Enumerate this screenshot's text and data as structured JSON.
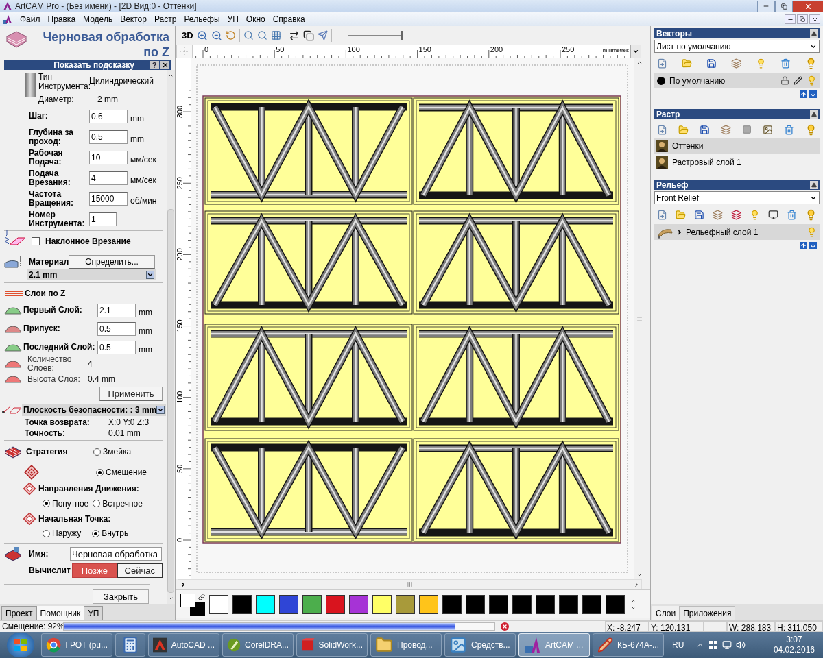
{
  "window": {
    "title": "ArtCAM Pro - (Без имени) - [2D Вид:0 - Оттенки]"
  },
  "menu": [
    "Файл",
    "Правка",
    "Модель",
    "Вектор",
    "Растр",
    "Рельефы",
    "УП",
    "Окно",
    "Справка"
  ],
  "left_panel": {
    "title": "Черновая обработка по Z",
    "hint": "Показать подсказку",
    "help": "?",
    "tool": {
      "type_label": "Тип Инструмента:",
      "type_value": "Цилиндрический",
      "diameter_label": "Диаметр:",
      "diameter_value": "2 mm"
    },
    "fields": [
      {
        "label": "Шаг:",
        "value": "0.6",
        "unit": "mm"
      },
      {
        "label": "Глубина за проход:",
        "value": "0.5",
        "unit": "mm"
      },
      {
        "label": "Рабочая Подача:",
        "value": "10",
        "unit": "мм/сек"
      },
      {
        "label": "Подача Врезания:",
        "value": "4",
        "unit": "мм/сек"
      },
      {
        "label": "Частота Вращения:",
        "value": "15000",
        "unit": "об/мин"
      },
      {
        "label": "Номер Инструмента:",
        "value": "1"
      }
    ],
    "ramp": {
      "label": "Наклонное Врезание",
      "checked": false
    },
    "material": {
      "label": "Материал",
      "button": "Определить...",
      "value": "2.1 mm"
    },
    "z_layers": {
      "title": "Слои по Z",
      "fields": [
        {
          "label": "Первый Слой:",
          "value": "2.1",
          "unit": "mm"
        },
        {
          "label": "Припуск:",
          "value": "0.5",
          "unit": "mm"
        },
        {
          "label": "Последний Слой:",
          "value": "0.5",
          "unit": "mm"
        }
      ],
      "info": [
        {
          "label": "Количество Слоев:",
          "value": "4"
        },
        {
          "label": "Высота Слоя:",
          "value": "0.4 mm"
        }
      ],
      "apply": "Применить"
    },
    "safe": {
      "label": "Плоскость безопасности: : 3 mm",
      "rows": [
        {
          "label": "Точка возврата:",
          "value": "X:0 Y:0 Z:3"
        },
        {
          "label": "Точность:",
          "value": "0.01 mm"
        }
      ]
    },
    "strategy": {
      "label": "Стратегия",
      "options": [
        {
          "label": "Змейка",
          "selected": false
        },
        {
          "label": "Смещение",
          "selected": true
        }
      ]
    },
    "direction": {
      "label": "Направления Движения:",
      "options": [
        {
          "label": "Попутное",
          "selected": true
        },
        {
          "label": "Встречное",
          "selected": false
        }
      ]
    },
    "start": {
      "label": "Начальная Точка:",
      "options": [
        {
          "label": "Наружу",
          "selected": false
        },
        {
          "label": "Внутрь",
          "selected": true
        }
      ]
    },
    "name": {
      "label": "Имя:",
      "value": "Черновая обработка"
    },
    "compute": {
      "label": "Вычислит",
      "buttons": [
        {
          "label": "Позже",
          "selected": true
        },
        {
          "label": "Сейчас",
          "selected": false
        }
      ]
    },
    "close": "Закрыть",
    "tabs": [
      {
        "label": "Проект",
        "selected": false
      },
      {
        "label": "Помощник",
        "selected": true
      },
      {
        "label": "УП",
        "selected": false
      }
    ]
  },
  "view": {
    "toolbar_label": "3D",
    "slider": {
      "level": 1
    },
    "x_labels": [
      "0",
      "50",
      "100",
      "150",
      "200",
      "250"
    ],
    "unit": "millimetres",
    "y_labels": [
      "300",
      "250",
      "200",
      "150",
      "100",
      "50",
      "0"
    ],
    "palette": [
      {
        "color": "#ffffff"
      },
      {
        "color": "#000000"
      },
      {
        "color": "#00ffff"
      },
      {
        "color": "#2f45d6"
      },
      {
        "color": "#4cae4c"
      },
      {
        "color": "#d9141e"
      },
      {
        "color": "#a633d6"
      },
      {
        "color": "#ffff66"
      },
      {
        "color": "#a89a3a"
      },
      {
        "color": "#ffc41a"
      },
      {
        "color": "#000000"
      },
      {
        "color": "#000000"
      },
      {
        "color": "#000000"
      },
      {
        "color": "#000000"
      },
      {
        "color": "#000000"
      },
      {
        "color": "#000000"
      },
      {
        "color": "#000000"
      },
      {
        "color": "#000000"
      }
    ]
  },
  "right_panel": {
    "vectors": {
      "title": "Векторы",
      "sheet": "Лист по умолчанию",
      "layers": [
        {
          "label": "По умолчанию",
          "selected": true
        }
      ]
    },
    "raster": {
      "title": "Растр",
      "layers": [
        {
          "label": "Оттенки",
          "selected": true
        },
        {
          "label": "Растровый слой 1",
          "selected": false
        }
      ]
    },
    "relief": {
      "title": "Рельеф",
      "sheet": "Front Relief",
      "layers": [
        {
          "label": "Рельефный слой 1",
          "selected": true
        }
      ]
    },
    "tabs": [
      {
        "label": "Слои",
        "selected": true
      },
      {
        "label": "Приложения",
        "selected": false
      }
    ]
  },
  "status_bar": {
    "text": "Смещение: 92%",
    "level": 0.91,
    "x": "X: -8.247",
    "y": "Y: 120.131",
    "w": "W: 288.183",
    "h": "H: 311.050"
  },
  "taskbar": {
    "items": [
      {
        "kind": "browser",
        "label": "ГРОТ (pu...",
        "selected": false
      },
      {
        "kind": "calculator",
        "selected": false
      },
      {
        "kind": "cad",
        "label": "AutoCAD ...",
        "selected": false
      },
      {
        "kind": "vector",
        "label": "CorelDRA...",
        "selected": false
      },
      {
        "kind": "solid",
        "label": "SolidWork...",
        "selected": false
      },
      {
        "kind": "folder",
        "label": "Провод...",
        "selected": false
      },
      {
        "kind": "snipping",
        "label": "Средств...",
        "selected": false
      },
      {
        "kind": "cam",
        "label": "ArtCAM ...",
        "selected": true
      },
      {
        "kind": "editor",
        "label": "КБ-674А-...",
        "selected": false
      }
    ],
    "lang": "RU",
    "time": "3:07",
    "date": "04.02.2016"
  }
}
